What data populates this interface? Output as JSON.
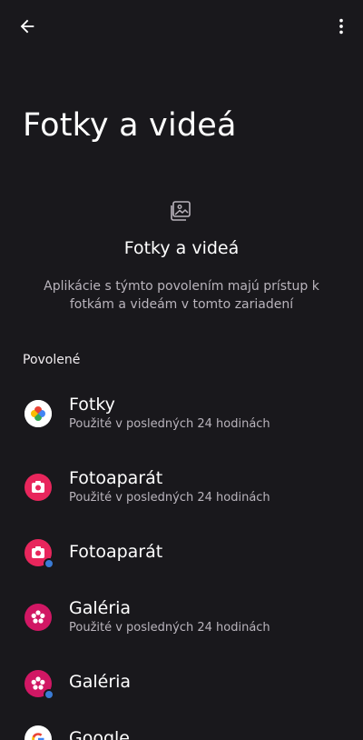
{
  "page": {
    "title": "Fotky a videá"
  },
  "header": {
    "icon": "photo-icon",
    "title": "Fotky a videá",
    "description": "Aplikácie s týmto povolením majú prístup k fotkám a videám v tomto zariadení"
  },
  "section": {
    "label": "Povolené"
  },
  "apps": [
    {
      "name": "Fotky",
      "subtitle": "Použité v posledných 24 hodinách",
      "icon": "google-photos-icon"
    },
    {
      "name": "Fotoaparát",
      "subtitle": "Použité v posledných 24 hodinách",
      "icon": "camera-icon"
    },
    {
      "name": "Fotoaparát",
      "subtitle": "",
      "icon": "camera-work-icon"
    },
    {
      "name": "Galéria",
      "subtitle": "Použité v posledných 24 hodinách",
      "icon": "gallery-icon"
    },
    {
      "name": "Galéria",
      "subtitle": "",
      "icon": "gallery-work-icon"
    },
    {
      "name": "Google",
      "subtitle": "",
      "icon": "google-icon"
    }
  ],
  "colors": {
    "background": "#19181c",
    "camera": "#e8265c",
    "gallery": "#d11764",
    "work_badge": "#3a7bd5"
  }
}
